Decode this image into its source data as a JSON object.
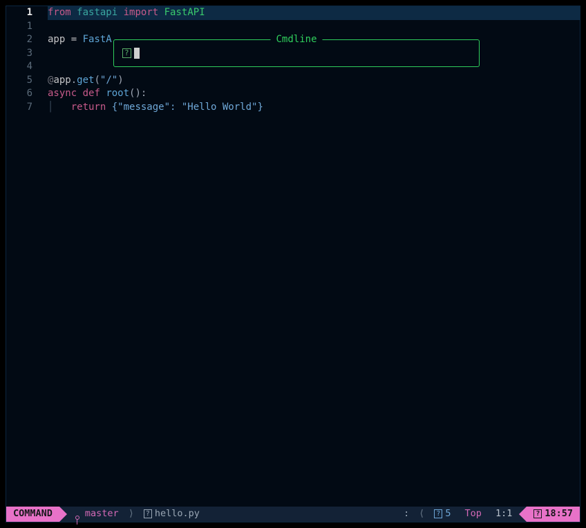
{
  "gutter": {
    "current_line": 1,
    "lines": [
      "1",
      "1",
      "2",
      "3",
      "4",
      "5",
      "6",
      "7"
    ]
  },
  "code": {
    "l0": {
      "from": "from",
      "mod": "fastapi",
      "import": "import",
      "cls": "FastAPI"
    },
    "l2": {
      "lhs": "app = ",
      "call": "FastA"
    },
    "l5": {
      "at": "@",
      "obj": "app",
      "dot": ".",
      "fn": "get",
      "open": "(",
      "str": "\"/\"",
      "close": ")"
    },
    "l6": {
      "async": "async",
      "def": "def",
      "name": "root",
      "sig": "():"
    },
    "l7": {
      "bar": "│   ",
      "ret": "return",
      "body": " {\"message\": \"Hello World\"}"
    }
  },
  "cmdline": {
    "title": "Cmdline",
    "prompt_glyph": "?",
    "value": ""
  },
  "status": {
    "mode": "COMMAND",
    "branch": "master",
    "file_glyph": "?",
    "file": "hello.py",
    "colon": ":",
    "diag_glyph": "?",
    "diag_count": "5",
    "scroll": "Top",
    "linecol": "1:1",
    "clock_glyph": "?",
    "clock": "18:57"
  }
}
